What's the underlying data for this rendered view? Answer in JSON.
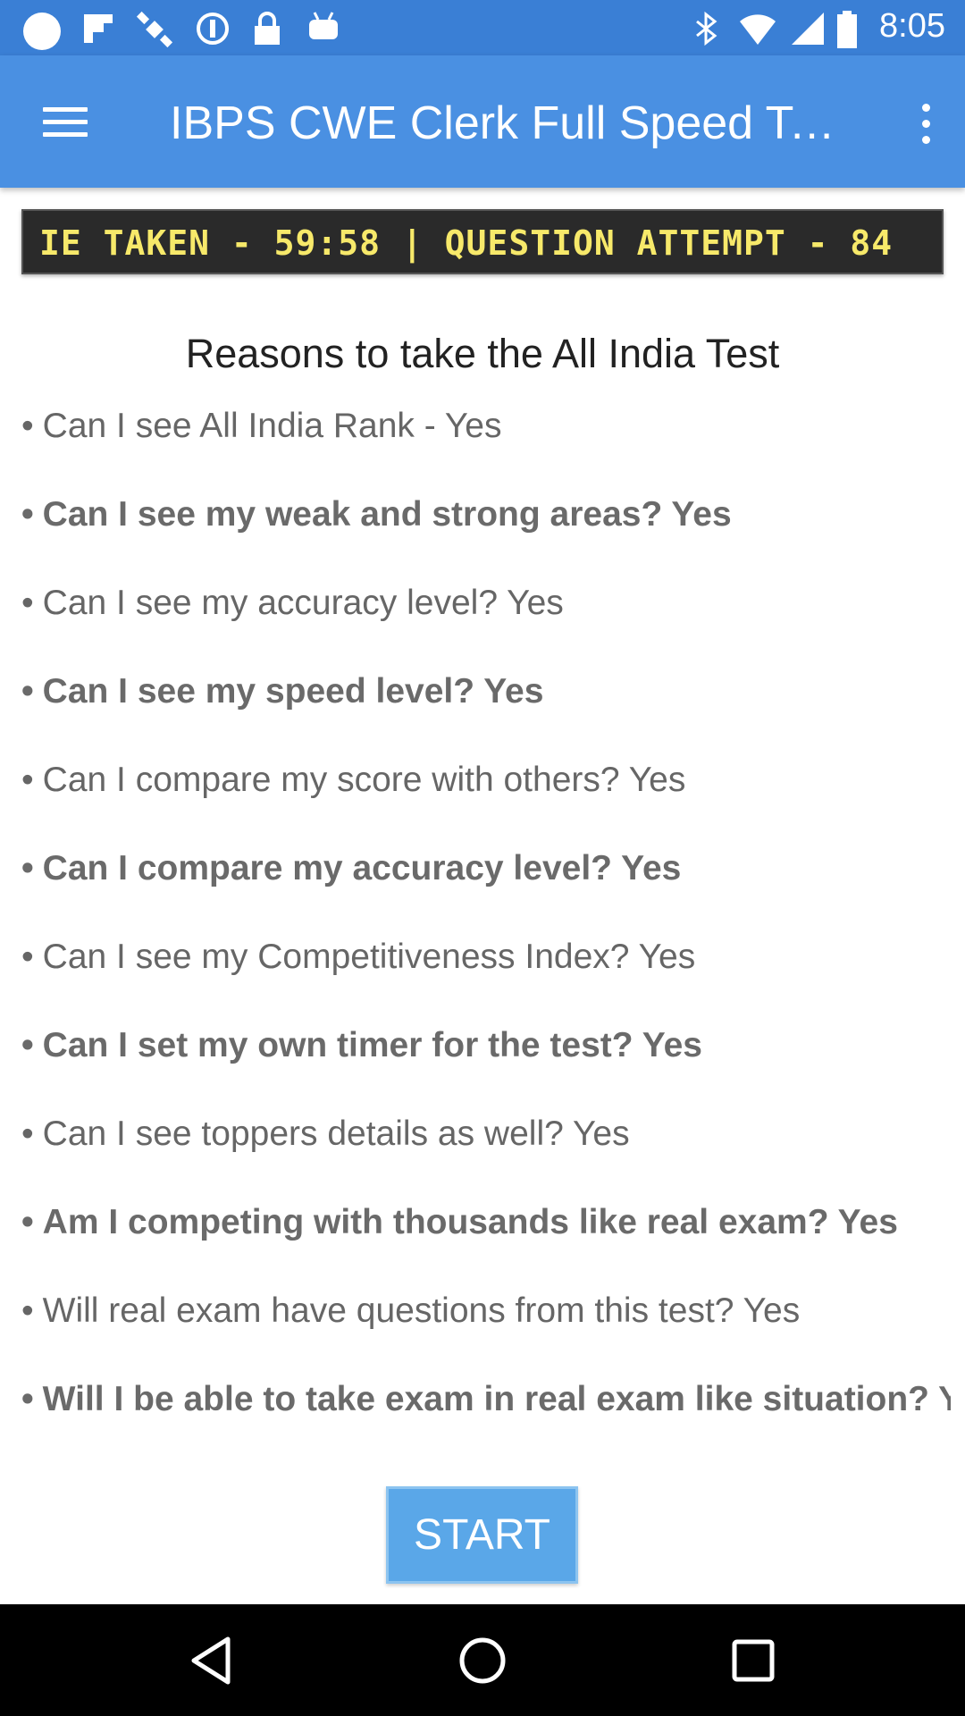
{
  "status_bar": {
    "time": "8:05",
    "icons": [
      "circle-icon",
      "flipboard-icon",
      "satellite-icon",
      "vpn-icon",
      "lock-icon",
      "android-icon",
      "bluetooth-icon",
      "wifi-icon",
      "signal-icon",
      "battery-icon"
    ]
  },
  "app_bar": {
    "title": "IBPS CWE Clerk Full Speed Tes…",
    "menu_icon": "hamburger-menu-icon",
    "more_icon": "more-vert-icon"
  },
  "ticker": {
    "text": "IE TAKEN - 59:58 | QUESTION ATTEMPT - 84"
  },
  "main": {
    "title": "Reasons to take the All India Test",
    "reasons": [
      {
        "text": "Can I see All India Rank - Yes",
        "bold": false
      },
      {
        "text": "Can I see my weak and strong areas? Yes",
        "bold": true
      },
      {
        "text": "Can I see my accuracy level? Yes",
        "bold": false
      },
      {
        "text": "Can I see my speed level? Yes",
        "bold": true
      },
      {
        "text": "Can I compare my score with others? Yes",
        "bold": false
      },
      {
        "text": "Can I compare my accuracy level? Yes",
        "bold": true
      },
      {
        "text": "Can I see my Competitiveness Index? Yes",
        "bold": false
      },
      {
        "text": "Can I set my own timer for the test? Yes",
        "bold": true
      },
      {
        "text": "Can I see toppers details as well? Yes",
        "bold": false
      },
      {
        "text": "Am I competing with thousands like real exam? Yes",
        "bold": true
      },
      {
        "text": "Will real exam have questions from this test? Yes",
        "bold": false
      },
      {
        "text": "Will I be able to take exam in real exam like situation? Yes",
        "bold": true
      }
    ],
    "bullet": "•"
  },
  "start_button": {
    "label": "START"
  },
  "nav_bar": {
    "back_icon": "back-triangle-icon",
    "home_icon": "home-circle-icon",
    "recents_icon": "recents-square-icon"
  },
  "colors": {
    "app_bar": "#4a90e2",
    "status_bar": "#3a7fd5",
    "ticker_bg": "#2a2a2a",
    "ticker_text": "#f7e96a",
    "start_button": "#5aa7e8"
  }
}
